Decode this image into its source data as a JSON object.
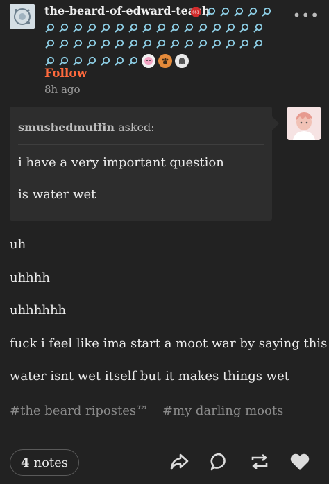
{
  "post": {
    "username": "the-beard-of-edward-teach",
    "follow_label": "Follow",
    "timestamp": "8h ago",
    "more_label": "•••"
  },
  "ask": {
    "asker": "smushedmuffin",
    "asked_suffix": " asked:",
    "question_line_1": "i have a very important question",
    "question_line_2": "is water wet"
  },
  "answer": {
    "lines": [
      "uh",
      "uhhhh",
      "uhhhhhh",
      "fuck i feel like ima start a moot war by saying this",
      "water isnt wet itself but it makes things wet"
    ]
  },
  "tags": [
    "#the beard ripostes™",
    "#my darling moots"
  ],
  "footer": {
    "notes_count": "4",
    "notes_label": "notes"
  },
  "colors": {
    "background": "#222222",
    "accent_follow": "#ff6a3d",
    "badge": "#8fd1e8"
  }
}
